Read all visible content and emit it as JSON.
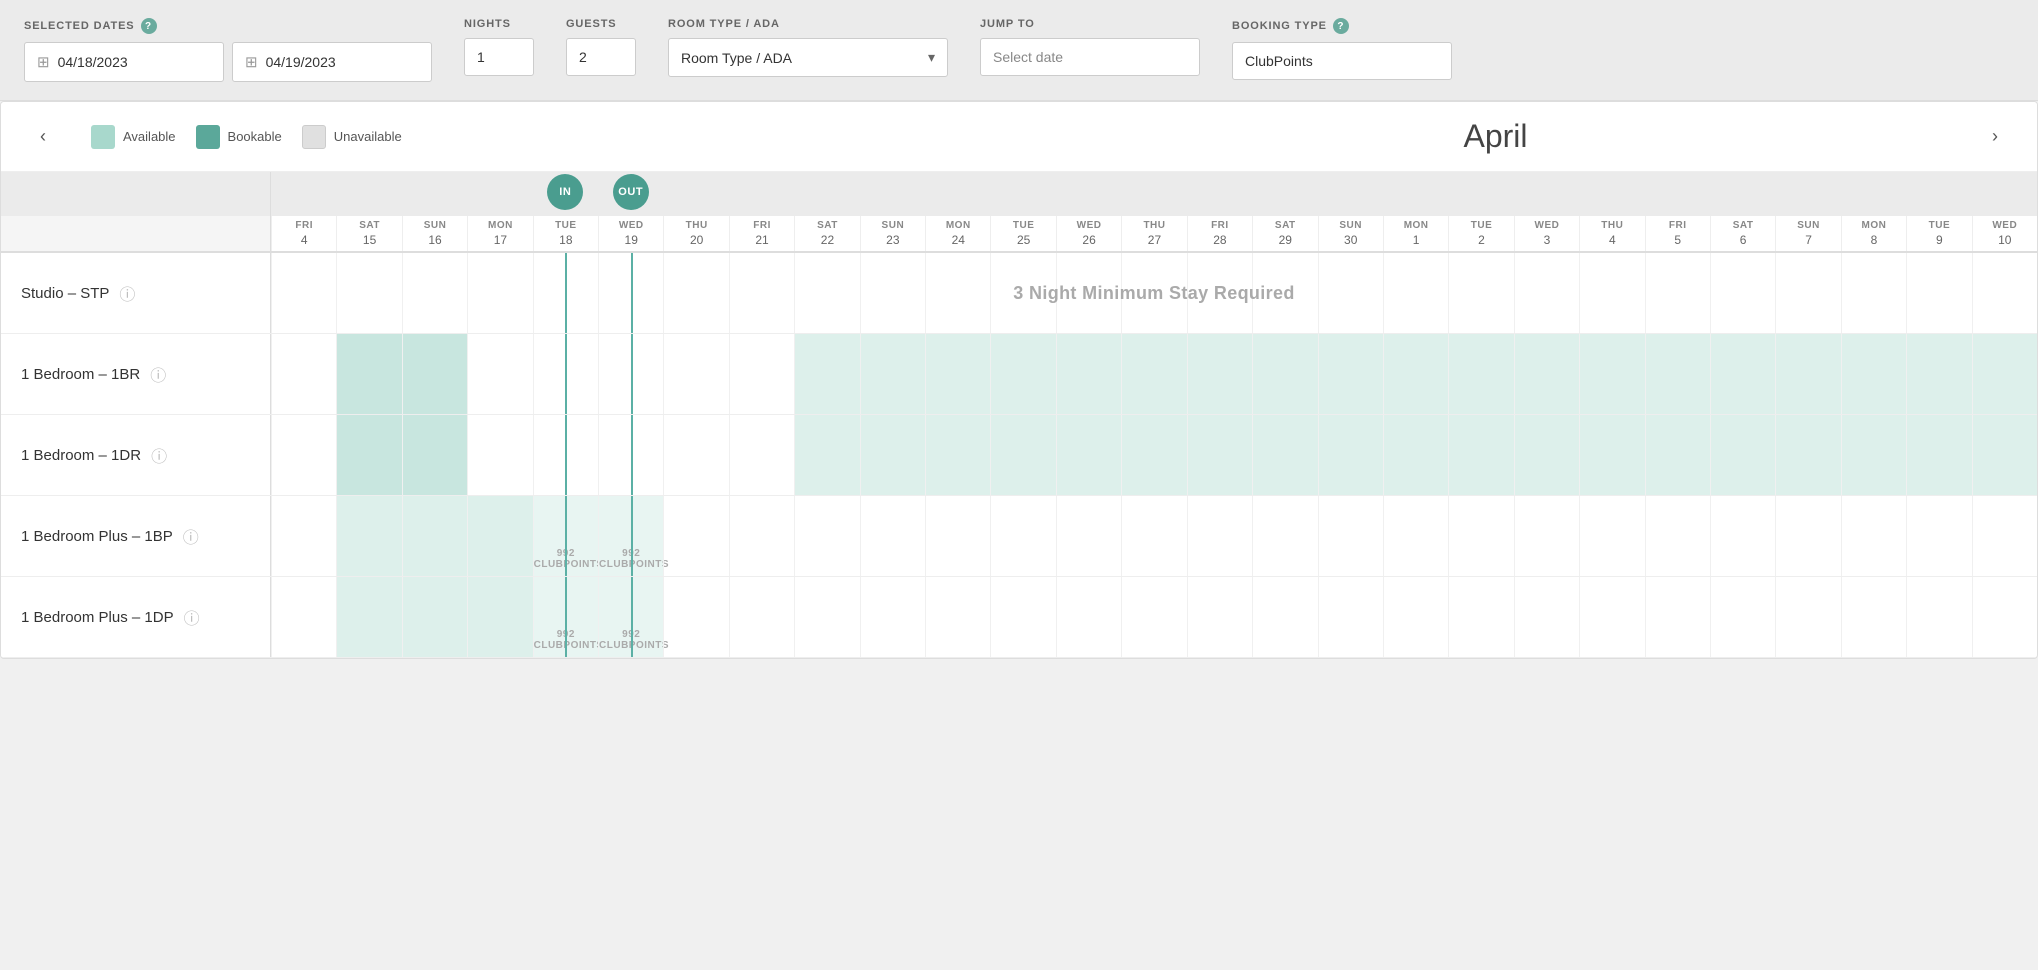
{
  "topBar": {
    "selectedDatesLabel": "SELECTED DATES",
    "nightsLabel": "NIGHTS",
    "guestsLabel": "GUESTS",
    "roomTypeLabel": "ROOM TYPE / ADA",
    "jumpToLabel": "JUMP TO",
    "bookingTypeLabel": "BOOKING TYPE",
    "date1": "04/18/2023",
    "date2": "04/19/2023",
    "nights": "1",
    "guests": "2",
    "roomType": "Room Type / ADA",
    "jumpTo": "Select date",
    "bookingType": "ClubPoints"
  },
  "calendar": {
    "month": "April",
    "legend": {
      "available": "Available",
      "bookable": "Bookable",
      "unavailable": "Unavailable"
    },
    "inBadge": "IN",
    "outBadge": "OUT",
    "days": [
      {
        "dow": "FRI",
        "num": "4"
      },
      {
        "dow": "SAT",
        "num": "15"
      },
      {
        "dow": "SUN",
        "num": "16"
      },
      {
        "dow": "MON",
        "num": "17"
      },
      {
        "dow": "TUE",
        "num": "18"
      },
      {
        "dow": "WED",
        "num": "19"
      },
      {
        "dow": "THU",
        "num": "20"
      },
      {
        "dow": "FRI",
        "num": "21"
      },
      {
        "dow": "SAT",
        "num": "22"
      },
      {
        "dow": "SUN",
        "num": "23"
      },
      {
        "dow": "MON",
        "num": "24"
      },
      {
        "dow": "TUE",
        "num": "25"
      },
      {
        "dow": "WED",
        "num": "26"
      },
      {
        "dow": "THU",
        "num": "27"
      },
      {
        "dow": "FRI",
        "num": "28"
      },
      {
        "dow": "SAT",
        "num": "29"
      },
      {
        "dow": "SUN",
        "num": "30"
      },
      {
        "dow": "MON",
        "num": "1"
      },
      {
        "dow": "TUE",
        "num": "2"
      },
      {
        "dow": "WED",
        "num": "3"
      },
      {
        "dow": "THU",
        "num": "4"
      },
      {
        "dow": "FRI",
        "num": "5"
      },
      {
        "dow": "SAT",
        "num": "6"
      },
      {
        "dow": "SUN",
        "num": "7"
      },
      {
        "dow": "MON",
        "num": "8"
      },
      {
        "dow": "TUE",
        "num": "9"
      },
      {
        "dow": "WED",
        "num": "10"
      }
    ],
    "rooms": [
      {
        "name": "Studio – STP",
        "message": "3 Night Minimum Stay Required",
        "cells": [
          0,
          0,
          0,
          0,
          0,
          0,
          0,
          0,
          0,
          0,
          0,
          0,
          0,
          0,
          0,
          0,
          0,
          0,
          0,
          0,
          0,
          0,
          0,
          0,
          0,
          0,
          0
        ]
      },
      {
        "name": "1 Bedroom – 1BR",
        "message": "",
        "cells": [
          0,
          1,
          1,
          0,
          0,
          0,
          0,
          0,
          2,
          2,
          2,
          2,
          2,
          2,
          2,
          2,
          2,
          2,
          2,
          2,
          2,
          2,
          2,
          2,
          2,
          2,
          2
        ]
      },
      {
        "name": "1 Bedroom – 1DR",
        "message": "",
        "cells": [
          0,
          1,
          1,
          0,
          0,
          0,
          0,
          0,
          2,
          2,
          2,
          2,
          2,
          2,
          2,
          2,
          2,
          2,
          2,
          2,
          2,
          2,
          2,
          2,
          2,
          2,
          2
        ]
      },
      {
        "name": "1 Bedroom Plus – 1BP",
        "message": "",
        "cells": [
          0,
          2,
          2,
          2,
          3,
          3,
          0,
          0,
          0,
          0,
          0,
          0,
          0,
          0,
          0,
          0,
          0,
          0,
          0,
          0,
          0,
          0,
          0,
          0,
          0,
          0,
          0
        ],
        "points": "992 CLUBPOINTS"
      },
      {
        "name": "1 Bedroom Plus – 1DP",
        "message": "",
        "cells": [
          0,
          2,
          2,
          2,
          3,
          3,
          0,
          0,
          0,
          0,
          0,
          0,
          0,
          0,
          0,
          0,
          0,
          0,
          0,
          0,
          0,
          0,
          0,
          0,
          0,
          0,
          0
        ],
        "points": "992 CLUBPOINTS"
      }
    ]
  }
}
